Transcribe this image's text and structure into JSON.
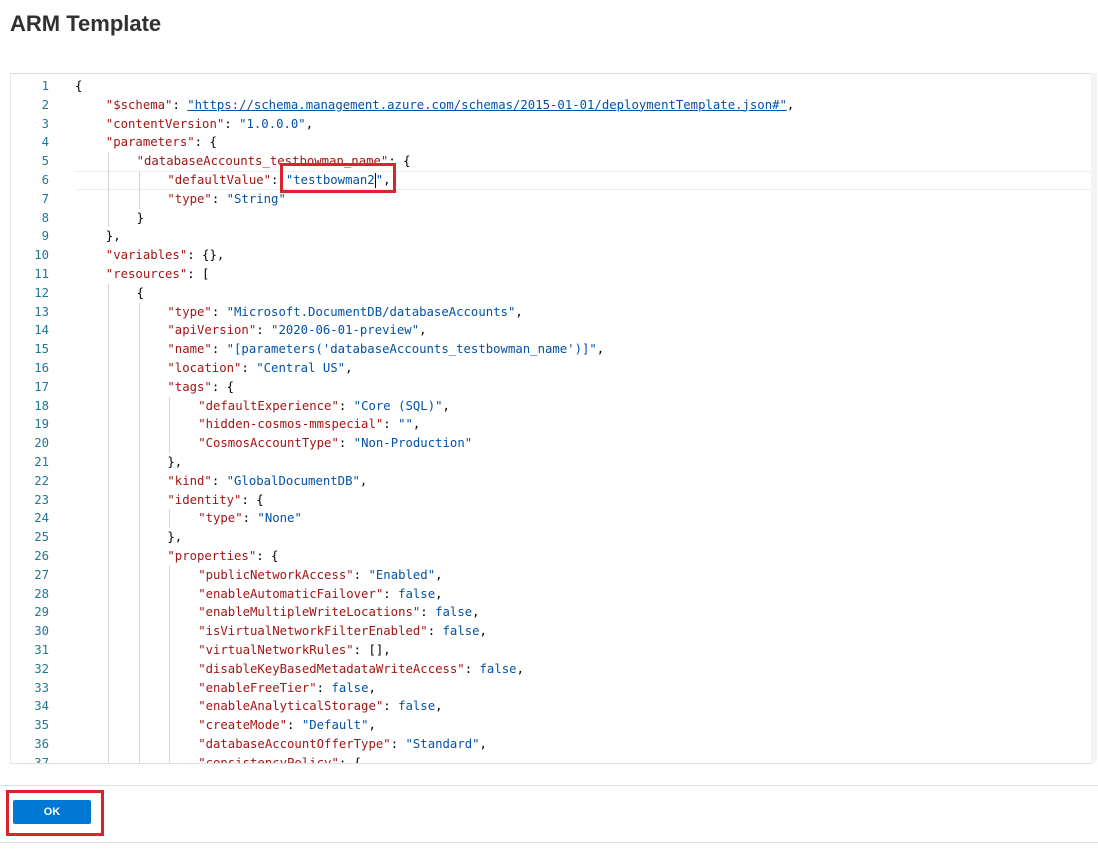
{
  "page": {
    "title": "ARM Template"
  },
  "editor": {
    "lines": [
      {
        "n": "1",
        "text": "{",
        "indent": 0
      },
      {
        "n": "2",
        "text": "\"$schema\": \"https://schema.management.azure.com/schemas/2015-01-01/deploymentTemplate.json#\",",
        "indent": 1
      },
      {
        "n": "3",
        "text": "\"contentVersion\": \"1.0.0.0\",",
        "indent": 1
      },
      {
        "n": "4",
        "text": "\"parameters\": {",
        "indent": 1
      },
      {
        "n": "5",
        "text": "\"databaseAccounts_testbowman_name\": {",
        "indent": 2
      },
      {
        "n": "6",
        "text": "\"defaultValue\": \"testbowman2\",",
        "indent": 3
      },
      {
        "n": "7",
        "text": "\"type\": \"String\"",
        "indent": 3
      },
      {
        "n": "8",
        "text": "}",
        "indent": 2
      },
      {
        "n": "9",
        "text": "},",
        "indent": 1
      },
      {
        "n": "10",
        "text": "\"variables\": {},",
        "indent": 1
      },
      {
        "n": "11",
        "text": "\"resources\": [",
        "indent": 1
      },
      {
        "n": "12",
        "text": "{",
        "indent": 2
      },
      {
        "n": "13",
        "text": "\"type\": \"Microsoft.DocumentDB/databaseAccounts\",",
        "indent": 3
      },
      {
        "n": "14",
        "text": "\"apiVersion\": \"2020-06-01-preview\",",
        "indent": 3
      },
      {
        "n": "15",
        "text": "\"name\": \"[parameters('databaseAccounts_testbowman_name')]\",",
        "indent": 3
      },
      {
        "n": "16",
        "text": "\"location\": \"Central US\",",
        "indent": 3
      },
      {
        "n": "17",
        "text": "\"tags\": {",
        "indent": 3
      },
      {
        "n": "18",
        "text": "\"defaultExperience\": \"Core (SQL)\",",
        "indent": 4
      },
      {
        "n": "19",
        "text": "\"hidden-cosmos-mmspecial\": \"\",",
        "indent": 4
      },
      {
        "n": "20",
        "text": "\"CosmosAccountType\": \"Non-Production\"",
        "indent": 4
      },
      {
        "n": "21",
        "text": "},",
        "indent": 3
      },
      {
        "n": "22",
        "text": "\"kind\": \"GlobalDocumentDB\",",
        "indent": 3
      },
      {
        "n": "23",
        "text": "\"identity\": {",
        "indent": 3
      },
      {
        "n": "24",
        "text": "\"type\": \"None\"",
        "indent": 4
      },
      {
        "n": "25",
        "text": "},",
        "indent": 3
      },
      {
        "n": "26",
        "text": "\"properties\": {",
        "indent": 3
      },
      {
        "n": "27",
        "text": "\"publicNetworkAccess\": \"Enabled\",",
        "indent": 4
      },
      {
        "n": "28",
        "text": "\"enableAutomaticFailover\": false,",
        "indent": 4
      },
      {
        "n": "29",
        "text": "\"enableMultipleWriteLocations\": false,",
        "indent": 4
      },
      {
        "n": "30",
        "text": "\"isVirtualNetworkFilterEnabled\": false,",
        "indent": 4
      },
      {
        "n": "31",
        "text": "\"virtualNetworkRules\": [],",
        "indent": 4
      },
      {
        "n": "32",
        "text": "\"disableKeyBasedMetadataWriteAccess\": false,",
        "indent": 4
      },
      {
        "n": "33",
        "text": "\"enableFreeTier\": false,",
        "indent": 4
      },
      {
        "n": "34",
        "text": "\"enableAnalyticalStorage\": false,",
        "indent": 4
      },
      {
        "n": "35",
        "text": "\"createMode\": \"Default\",",
        "indent": 4
      },
      {
        "n": "36",
        "text": "\"databaseAccountOfferType\": \"Standard\",",
        "indent": 4
      },
      {
        "n": "37",
        "text": "\"consistencyPolicy\": {",
        "indent": 4
      }
    ],
    "current_line": "6"
  },
  "footer": {
    "ok_label": "OK"
  },
  "colors": {
    "key": "#a31515",
    "string": "#0451a5",
    "line_number": "#237893",
    "accent": "#0078d4",
    "highlight": "#d9232d"
  }
}
